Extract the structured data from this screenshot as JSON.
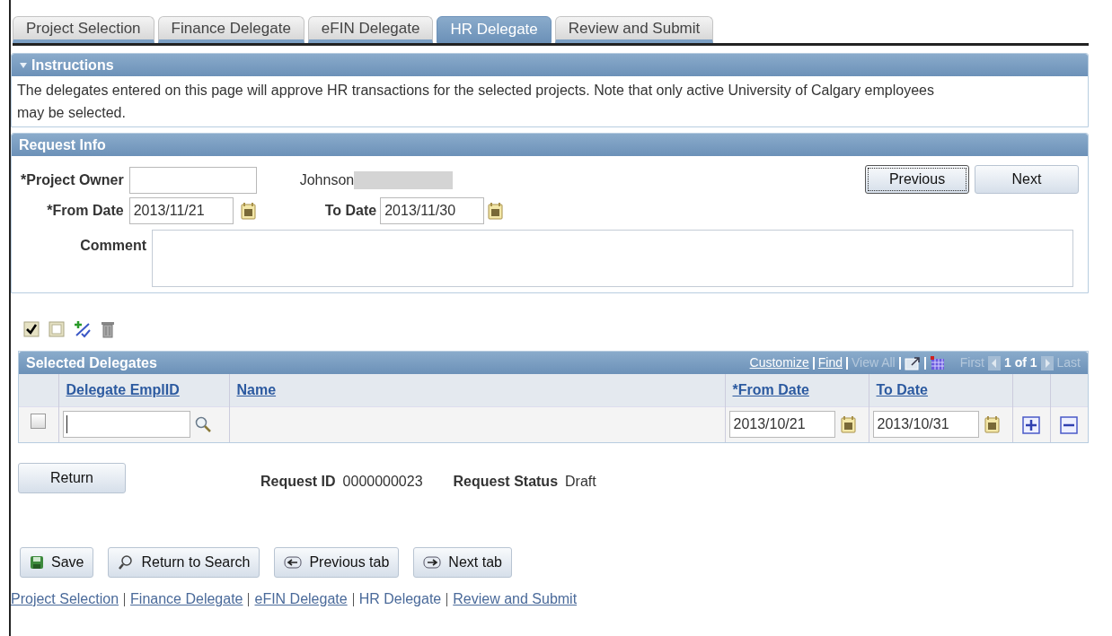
{
  "tabs": [
    {
      "label": "Project Selection",
      "selected": false
    },
    {
      "label": "Finance Delegate",
      "selected": false
    },
    {
      "label": "eFIN Delegate",
      "selected": false
    },
    {
      "label": "HR Delegate",
      "selected": true
    },
    {
      "label": "Review and Submit",
      "selected": false
    }
  ],
  "instructions": {
    "title": "Instructions",
    "expanded": true,
    "text": "The delegates entered on this page will approve HR transactions for the selected projects. Note that only active University of Calgary employees may be selected."
  },
  "request_info": {
    "title": "Request Info",
    "project_owner_label": "*Project Owner",
    "owner_name": "Johnson",
    "from_date": {
      "label": "*From Date",
      "value": "2013/11/21"
    },
    "to_date": {
      "label": "To Date",
      "value": "2013/11/30"
    },
    "comment_label": "Comment",
    "buttons": [
      {
        "label": "Previous",
        "focused": true
      },
      {
        "label": "Next",
        "focused": false
      }
    ]
  },
  "grid": {
    "title": "Selected Delegates",
    "nav": [
      {
        "label": "Customize",
        "enabled": true
      },
      {
        "label": "Find",
        "enabled": true
      },
      {
        "label": "View All",
        "enabled": false
      }
    ],
    "first": "First",
    "count": "1 of 1",
    "last": "Last",
    "columns": [
      "Delegate EmplID",
      "Name",
      "*From Date",
      "To Date"
    ],
    "rows": [
      {
        "checked": false,
        "emplid": "",
        "name": "",
        "from_date": "2013/10/21",
        "to_date": "2013/10/31"
      }
    ]
  },
  "return_button": "Return",
  "request_id": {
    "label": "Request ID",
    "value": "0000000023"
  },
  "request_status": {
    "label": "Request Status",
    "value": "Draft"
  },
  "action_buttons": [
    {
      "label": "Save",
      "kind": "save"
    },
    {
      "label": "Return to Search",
      "kind": "search"
    },
    {
      "label": "Previous tab",
      "kind": "prev"
    },
    {
      "label": "Next tab",
      "kind": "next"
    }
  ],
  "footer_links": [
    {
      "label": "Project Selection",
      "current": false
    },
    {
      "label": "Finance Delegate",
      "current": false
    },
    {
      "label": "eFIN Delegate",
      "current": false
    },
    {
      "label": "HR Delegate",
      "current": true
    },
    {
      "label": "Review and Submit",
      "current": false
    }
  ]
}
